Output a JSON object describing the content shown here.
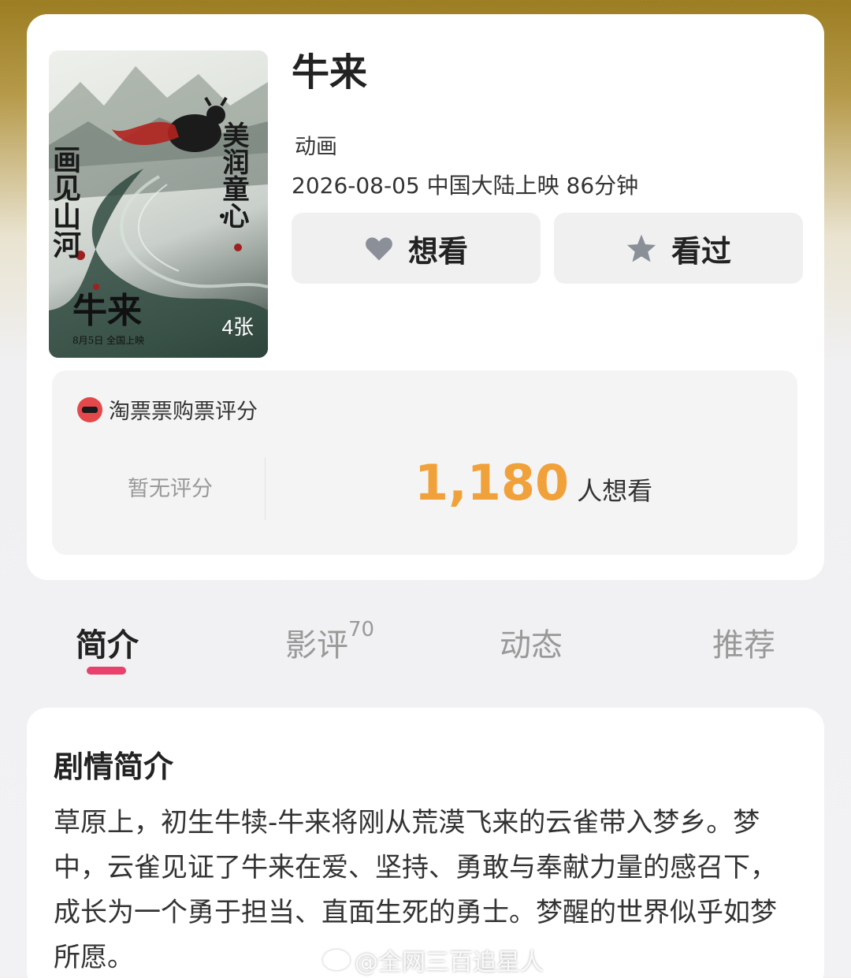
{
  "movie": {
    "title": "牛来",
    "genre": "动画",
    "release_info": "2026-08-05 中国大陆上映 86分钟",
    "poster_count": "4张",
    "poster_text": {
      "left": "画见山河",
      "right": "美润童心",
      "title": "牛来",
      "date": "8月5日 全国上映"
    }
  },
  "actions": {
    "want_label": "想看",
    "want_icon": "heart-icon",
    "seen_label": "看过",
    "seen_icon": "star-icon"
  },
  "rating": {
    "source": "淘票票购票评分",
    "source_icon": "taopiaopiao-logo-icon",
    "no_score": "暂无评分",
    "want_count": "1,180",
    "want_label": "人想看",
    "accent_color": "#f0a13a"
  },
  "tabs": [
    {
      "label": "简介",
      "active": true
    },
    {
      "label": "影评",
      "count": "70",
      "active": false
    },
    {
      "label": "动态",
      "active": false
    },
    {
      "label": "推荐",
      "active": false
    }
  ],
  "tab_indicator_color": "#e8416b",
  "synopsis": {
    "title": "剧情简介",
    "text": "草原上，初生牛犊-牛来将刚从荒漠飞来的云雀带入梦乡。梦中，云雀见证了牛来在爱、坚持、勇敢与奉献力量的感召下，成长为一个勇于担当、直面生死的勇士。梦醒的世界似乎如梦所愿。"
  },
  "watermark": "@全网三百追星人"
}
